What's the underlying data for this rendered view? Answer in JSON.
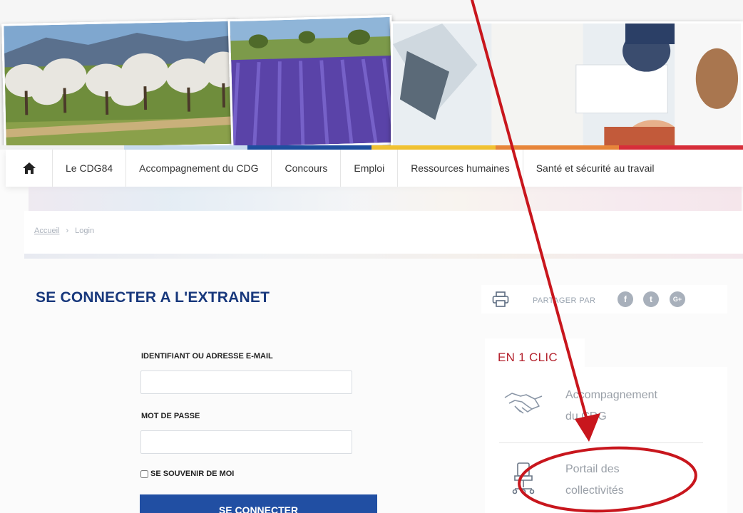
{
  "nav": {
    "items": [
      {
        "label": "Le CDG84"
      },
      {
        "label": "Accompagnement du CDG"
      },
      {
        "label": "Concours"
      },
      {
        "label": "Emploi"
      },
      {
        "label": "Ressources humaines"
      },
      {
        "label": "Santé et sécurité au travail"
      }
    ],
    "strip_colors": [
      "#f1f1f1",
      "#c9dcef",
      "#1f4fa0",
      "#f1c232",
      "#e8863a",
      "#d82e3a"
    ]
  },
  "breadcrumb": {
    "home": "Accueil",
    "separator": "›",
    "current": "Login"
  },
  "main": {
    "title": "SE CONNECTER A L'EXTRANET",
    "login_label": "IDENTIFIANT OU ADRESSE E-MAIL",
    "login_value": "",
    "password_label": "MOT DE PASSE",
    "password_value": "",
    "remember_label": "SE SOUVENIR DE MOI",
    "submit_label": "SE CONNECTER"
  },
  "share": {
    "label": "PARTAGER PAR",
    "networks": [
      {
        "name": "facebook",
        "glyph": "f"
      },
      {
        "name": "twitter",
        "glyph": "t"
      },
      {
        "name": "google-plus",
        "glyph": "G+"
      }
    ]
  },
  "en1clic": {
    "title": "EN 1 CLIC",
    "links": [
      {
        "line1": "Accompagnement",
        "line2": "du CDG",
        "icon": "handshake-icon"
      },
      {
        "line1": "Portail des",
        "line2": "collectivités",
        "icon": "office-chair-icon"
      }
    ]
  },
  "colors": {
    "brand_blue": "#18387c",
    "button_blue": "#214fa3",
    "clic_red": "#b4222d",
    "annotation_red": "#c8161d"
  }
}
